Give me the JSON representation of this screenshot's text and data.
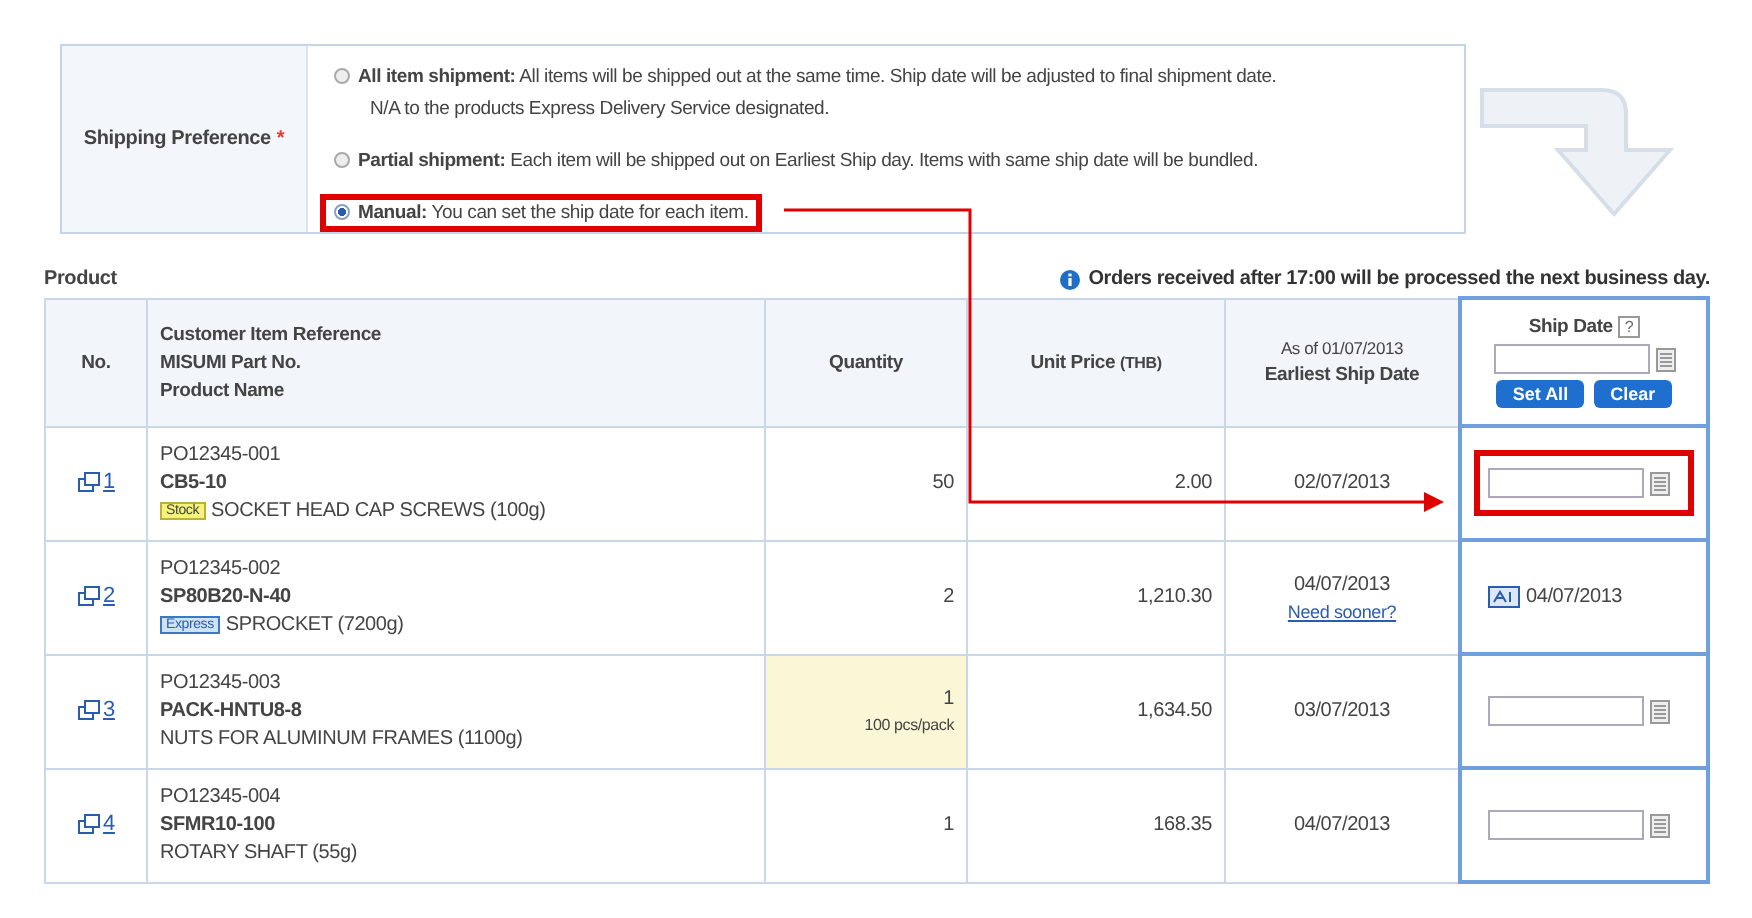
{
  "shipping_preference": {
    "label": "Shipping Preference",
    "required_mark": "*",
    "options": [
      {
        "title": "All item shipment:",
        "text": "All items will be shipped out at the same time. Ship date will be adjusted to final shipment date.",
        "note": "N/A to the products Express Delivery Service designated.",
        "selected": false,
        "highlighted": false
      },
      {
        "title": "Partial shipment:",
        "text": "Each item will be shipped out on Earliest Ship day. Items with same ship date will be bundled.",
        "selected": false,
        "highlighted": false
      },
      {
        "title": "Manual:",
        "text": "You can set the ship date for each item.",
        "selected": true,
        "highlighted": true
      }
    ]
  },
  "product_label": "Product",
  "notice": "Orders received after 17:00 will be processed the next business day.",
  "table": {
    "columns": {
      "no": "No.",
      "item": [
        "Customer Item Reference",
        "MISUMI Part No.",
        "Product Name"
      ],
      "quantity": "Quantity",
      "price": "Unit Price",
      "price_unit": "(THB)",
      "earliest_as_of": "As of 01/07/2013",
      "earliest": "Earliest Ship Date",
      "ship_date": "Ship Date",
      "help": "?",
      "set_all": "Set All",
      "clear": "Clear"
    },
    "rows": [
      {
        "no": "1",
        "reference": "PO12345-001",
        "part_no": "CB5-10",
        "badge": {
          "kind": "stock",
          "text": "Stock"
        },
        "name": "SOCKET HEAD CAP SCREWS (100g)",
        "quantity": "50",
        "price": "2.00",
        "earliest": "02/07/2013",
        "ship": {
          "kind": "input"
        },
        "highlighted": true
      },
      {
        "no": "2",
        "reference": "PO12345-002",
        "part_no": "SP80B20-N-40",
        "badge": {
          "kind": "express",
          "text": "Express"
        },
        "name": "SPROCKET (7200g)",
        "quantity": "2",
        "price": "1,210.30",
        "earliest": "04/07/2013",
        "link": "Need sooner?",
        "ship": {
          "kind": "fixed",
          "value": "04/07/2013"
        },
        "highlighted": false
      },
      {
        "no": "3",
        "reference": "PO12345-003",
        "part_no": "PACK-HNTU8-8",
        "name": "NUTS FOR ALUMINUM FRAMES (1100g)",
        "quantity": "1",
        "quantity_note": "100 pcs/pack",
        "price": "1,634.50",
        "earliest": "03/07/2013",
        "ship": {
          "kind": "input"
        },
        "highlighted": false
      },
      {
        "no": "4",
        "reference": "PO12345-004",
        "part_no": "SFMR10-100",
        "name": "ROTARY SHAFT (55g)",
        "quantity": "1",
        "price": "168.35",
        "earliest": "04/07/2013",
        "ship": {
          "kind": "input"
        },
        "highlighted": false
      }
    ]
  }
}
